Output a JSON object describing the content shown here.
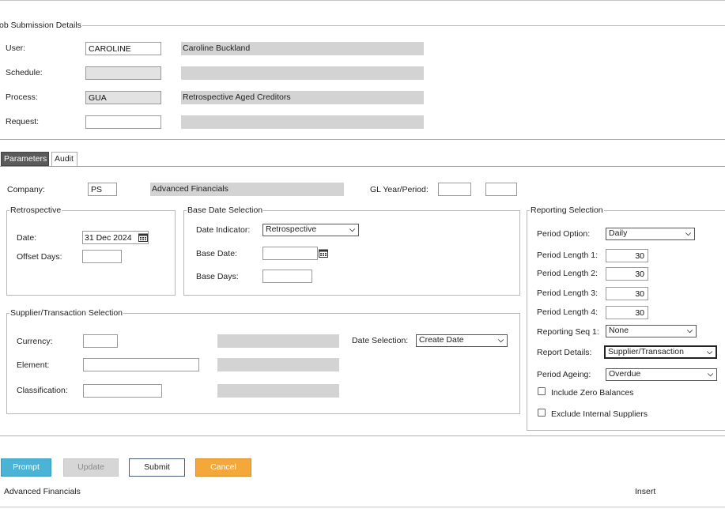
{
  "job": {
    "legend": "ob Submission Details",
    "user_label": "User:",
    "user_code": "CAROLINE",
    "user_name": "Caroline Buckland",
    "schedule_label": "Schedule:",
    "process_label": "Process:",
    "process_code": "GUA",
    "process_name": "Retrospective Aged Creditors",
    "request_label": "Request:"
  },
  "tabs": [
    {
      "label": "Parameters",
      "active": true
    },
    {
      "label": "Audit",
      "active": false
    }
  ],
  "company": {
    "label": "Company:",
    "code": "PS",
    "name": "Advanced Financials",
    "gl_label": "GL Year/Period:"
  },
  "retrospective": {
    "legend": "Retrospective",
    "date_label": "Date:",
    "date_value": "31 Dec 2024",
    "offset_label": "Offset Days:"
  },
  "base_date": {
    "legend": "Base Date Selection",
    "indicator_label": "Date Indicator:",
    "indicator_value": "Retrospective",
    "base_date_label": "Base Date:",
    "base_days_label": "Base Days:"
  },
  "supplier": {
    "legend": "Supplier/Transaction Selection",
    "currency_label": "Currency:",
    "element_label": "Element:",
    "classification_label": "Classification:",
    "date_selection_label": "Date Selection:",
    "date_selection_value": "Create Date"
  },
  "reporting": {
    "legend": "Reporting Selection",
    "period_option_label": "Period Option:",
    "period_option_value": "Daily",
    "pl1_label": "Period Length 1:",
    "pl1_value": "30",
    "pl2_label": "Period Length 2:",
    "pl2_value": "30",
    "pl3_label": "Period Length 3:",
    "pl3_value": "30",
    "pl4_label": "Period Length 4:",
    "pl4_value": "30",
    "seq_label": "Reporting Seq 1:",
    "seq_value": "None",
    "details_label": "Report Details:",
    "details_value": "Supplier/Transaction",
    "ageing_label": "Period Ageing:",
    "ageing_value": "Overdue",
    "zero_label": "Include Zero Balances",
    "internal_label": "Exclude Internal Suppliers"
  },
  "buttons": {
    "prompt": "Prompt",
    "update": "Update",
    "submit": "Submit",
    "cancel": "Cancel"
  },
  "status": {
    "app": "Advanced Financials",
    "mode": "Insert"
  },
  "colors": {
    "prompt_bg": "#4ab3d6",
    "cancel_bg": "#f5a83a",
    "active_tab": "#5a5a5a",
    "readonly_grey": "#d3d3d3"
  }
}
